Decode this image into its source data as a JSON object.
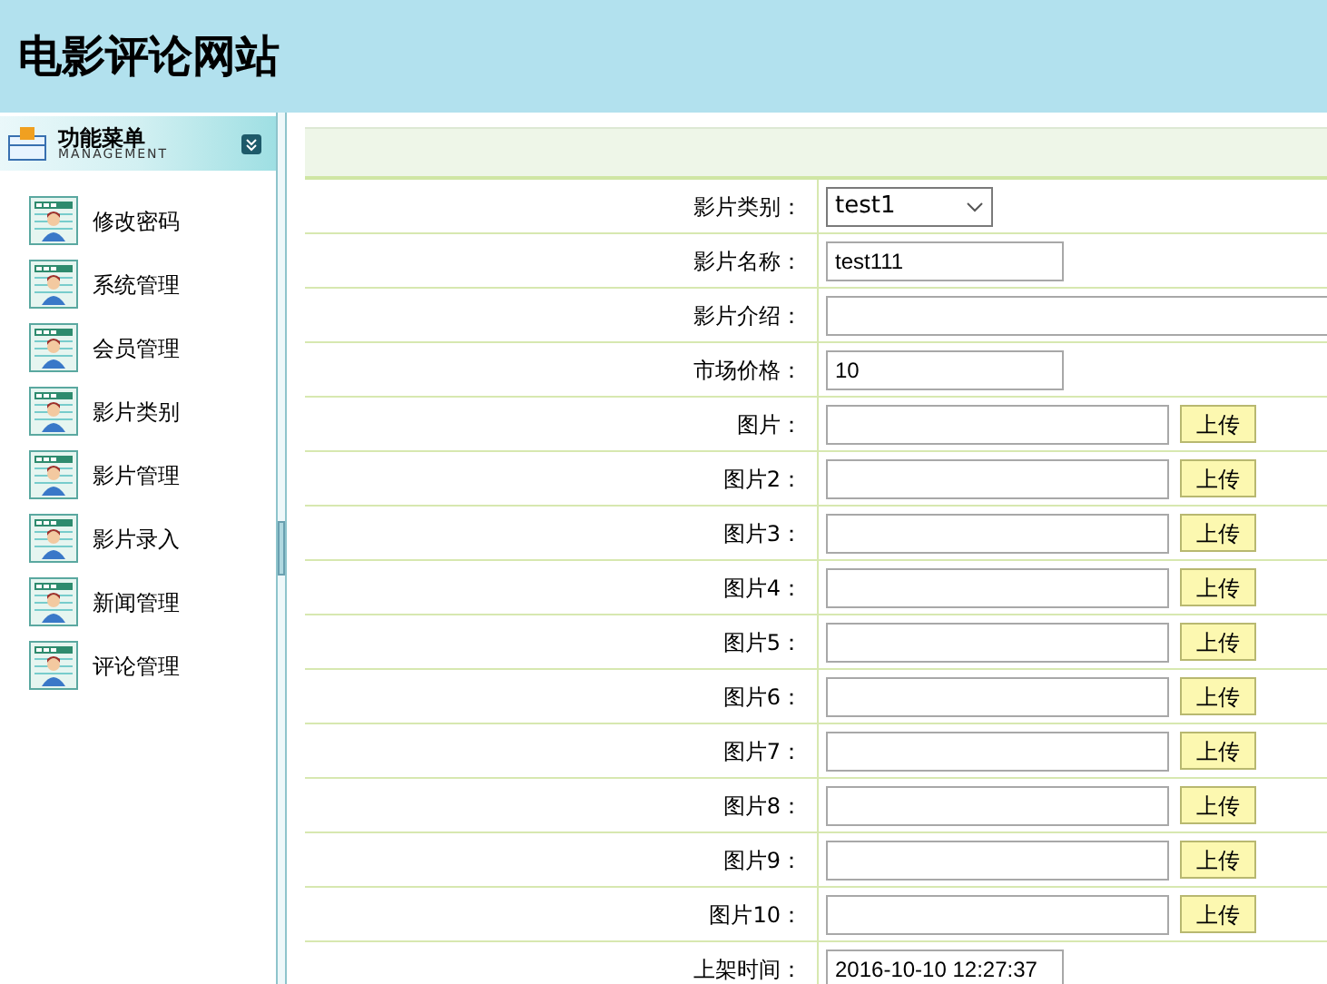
{
  "header": {
    "title": "电影评论网站"
  },
  "sidebar": {
    "title": "功能菜单",
    "subtitle": "MANAGEMENT",
    "items": [
      {
        "label": "修改密码"
      },
      {
        "label": "系统管理"
      },
      {
        "label": "会员管理"
      },
      {
        "label": "影片类别"
      },
      {
        "label": "影片管理"
      },
      {
        "label": "影片录入"
      },
      {
        "label": "新闻管理"
      },
      {
        "label": "评论管理"
      }
    ]
  },
  "form": {
    "rows": [
      {
        "kind": "select",
        "label": "影片类别：",
        "value": "test1"
      },
      {
        "kind": "text",
        "label": "影片名称：",
        "value": "test111"
      },
      {
        "kind": "wide",
        "label": "影片介绍：",
        "value": ""
      },
      {
        "kind": "text",
        "label": "市场价格：",
        "value": "10"
      },
      {
        "kind": "upload",
        "label": "图片：",
        "button": "上传"
      },
      {
        "kind": "upload",
        "label": "图片2：",
        "button": "上传"
      },
      {
        "kind": "upload",
        "label": "图片3：",
        "button": "上传"
      },
      {
        "kind": "upload",
        "label": "图片4：",
        "button": "上传"
      },
      {
        "kind": "upload",
        "label": "图片5：",
        "button": "上传"
      },
      {
        "kind": "upload",
        "label": "图片6：",
        "button": "上传"
      },
      {
        "kind": "upload",
        "label": "图片7：",
        "button": "上传"
      },
      {
        "kind": "upload",
        "label": "图片8：",
        "button": "上传"
      },
      {
        "kind": "upload",
        "label": "图片9：",
        "button": "上传"
      },
      {
        "kind": "upload",
        "label": "图片10：",
        "button": "上传"
      },
      {
        "kind": "text",
        "label": "上架时间：",
        "value": "2016-10-10 12:27:37"
      }
    ]
  }
}
